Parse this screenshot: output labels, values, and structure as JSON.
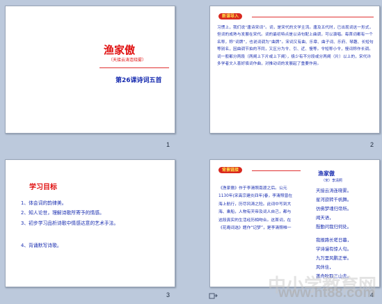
{
  "slides": [
    {
      "number": "1",
      "title": "渔家傲",
      "subtitle": "（天接云涛连晓雾）",
      "lesson": "第26课诗词五首"
    },
    {
      "number": "2",
      "tag": "新课导入",
      "paragraph": "习惯上，我们说“唐诗宋词”。词，是宋代的文学主流。唐及五代时，已出现词这一形式，但词的成熟与发展在宋代。词的最初特点是以诗句配上曲调，可以演唱。每首词都有一个名称，称“词牌”，也说词调为“曲牌”。宋词又有曲、乐章、曲子词、乐府、琴趣、长短句等别名，因曲调节拍的不同，又区分为令、引、近、慢等。令短称小令，慢词称作长调。词一般都分两段（两阕上下片或上下阕），极少有不分段或分两阕（片）以上的，宋代许多学者文人喜好填词作曲，对推动词的发展起了重要作用。"
    },
    {
      "number": "3",
      "goals_title": "学习目标",
      "goals": [
        "1、体会词的韵律美。",
        "2、知人论世，理解诗歌所寄予的情感。",
        "3、初步学习品析诗歌中情感达意的艺术手法。",
        "4、背诵默写诗歌。"
      ]
    },
    {
      "number": "4",
      "tag": "背景链接",
      "paragraph": "《渔家傲》作于李清照南渡之后。公元1130年(宋高宗建炎四年)春，李清照曾在海上航行，历尽风涛之险。此词中写到大海、乘船，人物有天帝及词人自己，都与这段真实的生活经历相吻合。这首词，在《花庵词选》题作“记梦”，是李清照唯一",
      "poem_title": "渔家傲",
      "poem_author": "（宋）李清照",
      "poem_lines": [
        "天接云涛连晓雾。",
        "星河欲转千帆舞。",
        "仿佛梦魂归帝所。",
        "闻天语，",
        "殷勤问我归何处。",
        "我报路长嗟日暮，",
        "学诗谩有惊人句。",
        "九万里风鹏正举。",
        "风休住，",
        "蓬舟吹取三山去。"
      ],
      "nav_icon": "slide-transition-icon"
    }
  ],
  "watermark": {
    "text": "中小学教育网",
    "url": "www.ht88.com"
  },
  "colors": {
    "workspace": "#bcc9dc",
    "title_red": "#e01010",
    "body_blue": "#1a2eb0",
    "tag_bg": "#d9281f",
    "tag_text": "#ffe24a"
  }
}
